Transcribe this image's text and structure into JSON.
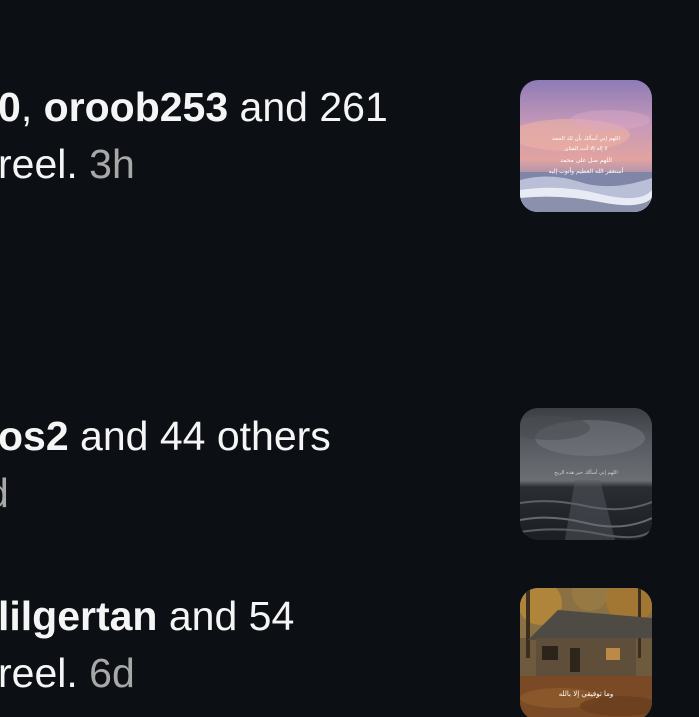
{
  "notifications": [
    {
      "line1": {
        "user1_tail": "0",
        "sep": ", ",
        "user2": "oroob253",
        "rest": " and 261"
      },
      "line2": {
        "text": "reel. ",
        "time": "3h"
      },
      "thumbnail": "sunset-sea-quote-thumbnail",
      "thumbnail_caption": [
        "اللهم إني أسألك بأن لك الحمد",
        "لا إله إلا أنت المنان",
        "اللهم صل على محمد",
        "أستغفر الله العظيم وأتوب إليه"
      ]
    },
    {
      "line1": {
        "user1_tail": "os2",
        "rest": " and 44 others"
      },
      "line2": {
        "text": "",
        "time": "d"
      },
      "thumbnail": "stormy-sea-thumbnail",
      "thumbnail_caption": [
        "اللهم إني أسألك خير هذه الريح"
      ]
    },
    {
      "line1": {
        "user1_tail": "lilgertan",
        "rest": " and 54"
      },
      "line2": {
        "text": "reel. ",
        "time": "6d"
      },
      "thumbnail": "cabin-autumn-thumbnail",
      "thumbnail_caption": [
        "وما توفيقي إلا بالله"
      ]
    }
  ],
  "colors": {
    "background": "#0c1014",
    "text": "#f5f5f5",
    "timestamp": "#a8a8a8"
  }
}
